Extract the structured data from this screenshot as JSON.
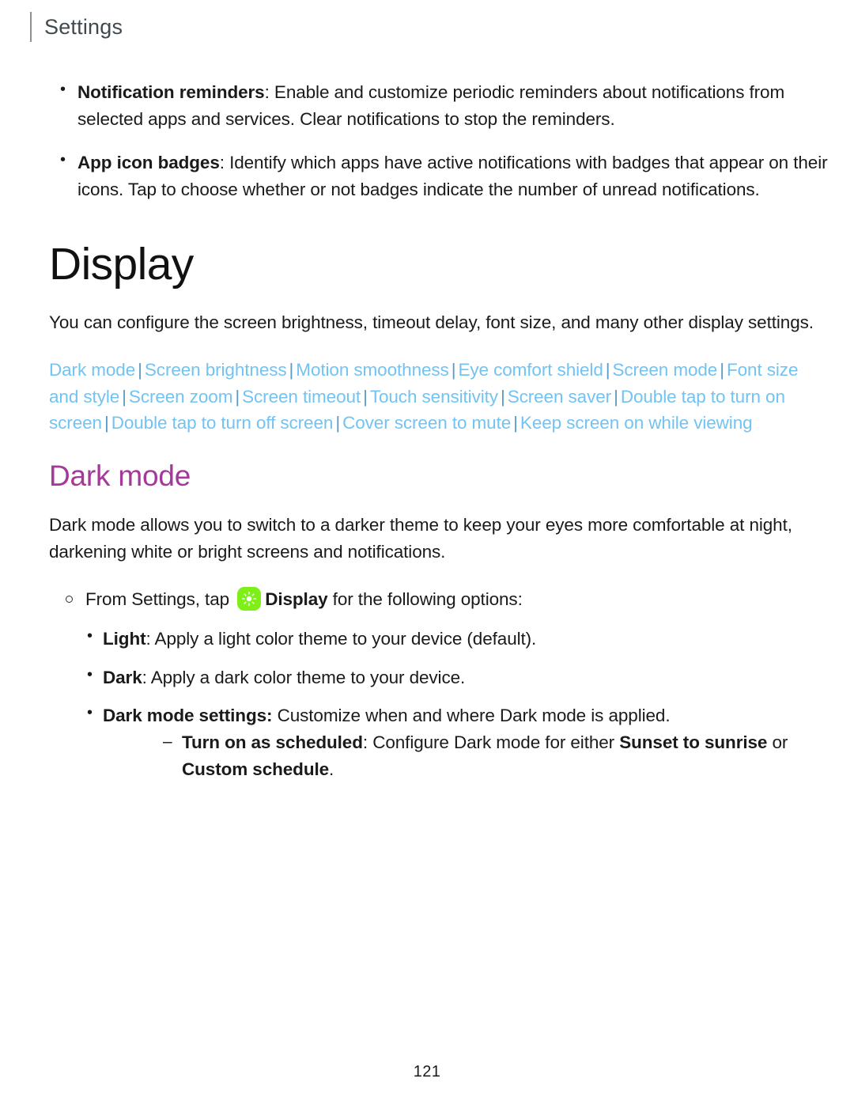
{
  "header": {
    "title": "Settings"
  },
  "top_bullets": [
    {
      "term": "Notification reminders",
      "separator": ": ",
      "text": "Enable and customize periodic reminders about notifications from selected apps and services. Clear notifications to stop the reminders."
    },
    {
      "term": "App icon badges",
      "separator": ": ",
      "text": "Identify which apps have active notifications with badges that appear on their icons. Tap to choose whether or not badges indicate the number of unread notifications."
    }
  ],
  "display_section": {
    "heading": "Display",
    "intro": "You can configure the screen brightness, timeout delay, font size, and many other display settings.",
    "links": [
      "Dark mode",
      "Screen brightness",
      "Motion smoothness",
      "Eye comfort shield",
      "Screen mode",
      "Font size and style",
      "Screen zoom",
      "Screen timeout",
      "Touch sensitivity",
      "Screen saver",
      "Double tap to turn on screen",
      "Double tap to turn off screen",
      "Cover screen to mute",
      "Keep screen on while viewing"
    ],
    "link_separator": "|"
  },
  "dark_mode_section": {
    "heading": "Dark mode",
    "intro": "Dark mode allows you to switch to a darker theme to keep your eyes more comfortable at night, darkening white or bright screens and notifications.",
    "instruction": {
      "prefix": "From Settings, tap ",
      "icon_label": "Display",
      "suffix": " for the following options:",
      "icon_name": "display-settings-icon",
      "icon_color": "#7ef018"
    },
    "options": [
      {
        "term": "Light",
        "separator": ": ",
        "text": "Apply a light color theme to your device (default)."
      },
      {
        "term": "Dark",
        "separator": ": ",
        "text": "Apply a dark color theme to your device."
      },
      {
        "term": "Dark mode settings:",
        "separator": " ",
        "text": "Customize when and where Dark mode is applied."
      }
    ],
    "schedule": {
      "term": "Turn on as scheduled",
      "separator": ": ",
      "text_before": "Configure Dark mode for either ",
      "emphasis_1": "Sunset to sunrise",
      "text_middle": " or ",
      "emphasis_2": "Custom schedule",
      "text_after": "."
    }
  },
  "footer": {
    "page_number": "121"
  },
  "colors": {
    "link": "#72c3f2",
    "link_separator": "#5a9cc4",
    "sub_heading": "#a4399a",
    "header_title": "#3f4a50",
    "body_text": "#1a1a1a"
  }
}
